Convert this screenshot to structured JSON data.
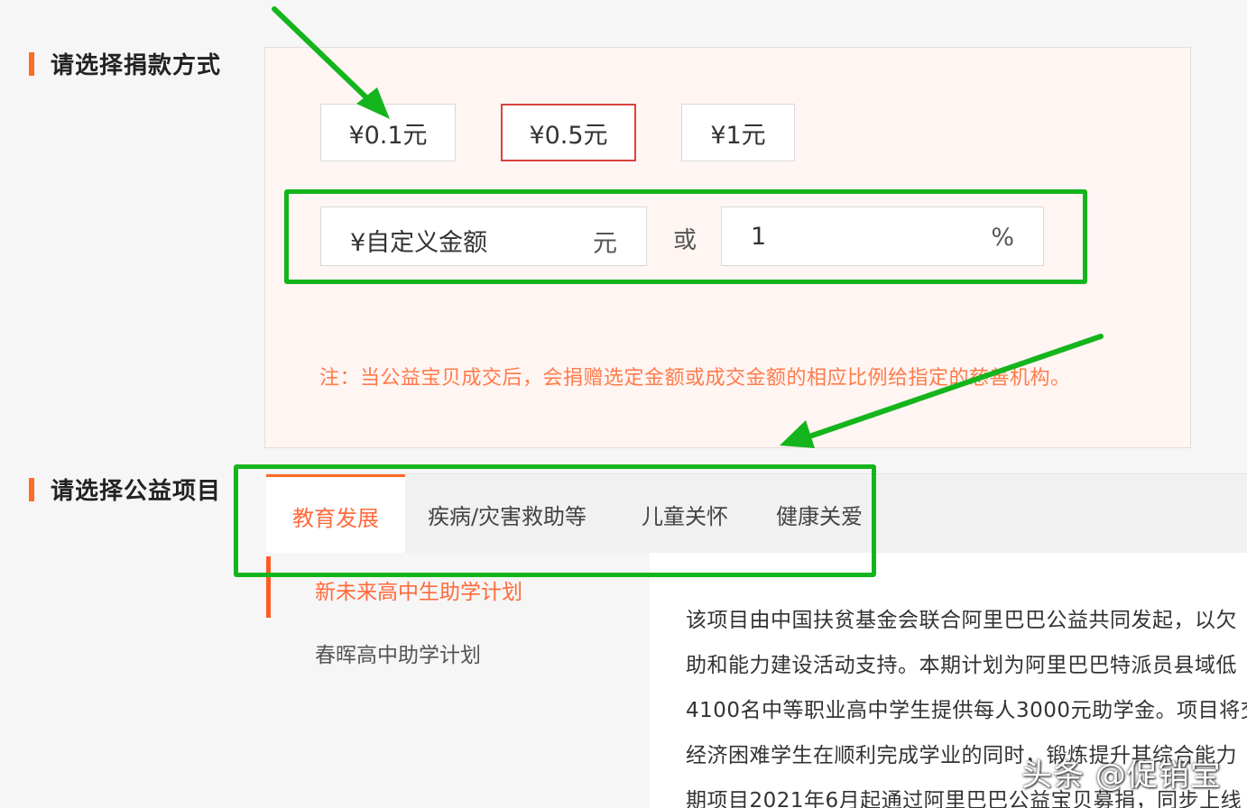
{
  "sections": {
    "donation_method_title": "请选择捐款方式",
    "project_title": "请选择公益项目"
  },
  "amounts": {
    "option_1": "¥0.1元",
    "option_2": "¥0.5元",
    "option_3": "¥1元",
    "selected": "¥0.5元"
  },
  "custom": {
    "placeholder": "¥自定义金额",
    "unit": "元",
    "or_label": "或",
    "percent_value": "1",
    "percent_unit": "%"
  },
  "note": "注：当公益宝贝成交后，会捐赠选定金额或成交金额的相应比例给指定的慈善机构。",
  "tabs": [
    {
      "label": "教育发展",
      "active": true
    },
    {
      "label": "疾病/灾害救助等",
      "active": false
    },
    {
      "label": "儿童关怀",
      "active": false
    },
    {
      "label": "健康关爱",
      "active": false
    }
  ],
  "projects": [
    {
      "label": "新未来高中生助学计划",
      "active": true
    },
    {
      "label": "春晖高中助学计划",
      "active": false
    }
  ],
  "description_lines": [
    "该项目由中国扶贫基金会联合阿里巴巴公益共同发起，以欠",
    "助和能力建设活动支持。本期计划为阿里巴巴特派员县域低",
    "4100名中等职业高中学生提供每人3000元助学金。项目将交",
    "经济困难学生在顺利完成学业的同时，锻炼提升其综合能力",
    "期项目2021年6月起通过阿里巴巴公益宝贝募捐，同步上线"
  ],
  "watermark": "头条 @促销宝",
  "colors": {
    "accent": "#ff6a24",
    "selected_border": "#d9433d",
    "annotation_green": "#14b51c",
    "note_text": "#ff7b4a"
  }
}
